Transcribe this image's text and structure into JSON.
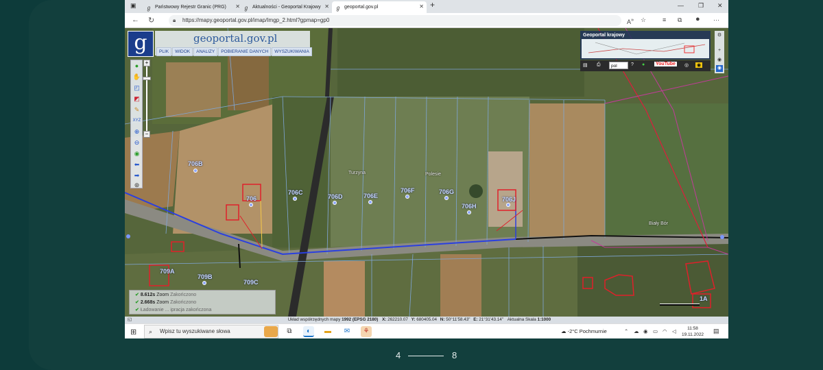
{
  "browser": {
    "tabs": [
      {
        "label": "Państwowy Rejestr Granic (PRG)"
      },
      {
        "label": "Aktualności - Geoportal Krajowy"
      },
      {
        "label": "geoportal.gov.pl"
      }
    ],
    "url": "https://mapy.geoportal.gov.pl/imap/Imgp_2.html?gpmap=gp0"
  },
  "geoportal": {
    "logo_letter": "g",
    "brand": "geoportal.gov.pl",
    "menu": [
      "PLIK",
      "WIDOK",
      "ANALIZY",
      "POBIERANIE DANYCH",
      "WYSZUKIWANIA"
    ],
    "minimap_title": "Geoportal krajowy",
    "language": "pol",
    "youtube_label": "YouTube"
  },
  "parcels": [
    {
      "id": "706B"
    },
    {
      "id": "706"
    },
    {
      "id": "706C"
    },
    {
      "id": "706D"
    },
    {
      "id": "706E"
    },
    {
      "id": "706F"
    },
    {
      "id": "706G"
    },
    {
      "id": "706H"
    },
    {
      "id": "706J"
    },
    {
      "id": "709A"
    },
    {
      "id": "709B"
    },
    {
      "id": "709C"
    },
    {
      "id": "1A"
    }
  ],
  "places": {
    "place1": "Turzyna",
    "place2": "Polesie",
    "place3": "Biały Bór"
  },
  "log": [
    {
      "time": "8.612s",
      "action": "Zoom",
      "status": "Zakończono"
    },
    {
      "time": "2.668s",
      "action": "Zoom",
      "status": "Zakończono"
    },
    {
      "time": "",
      "action": "",
      "status": "Ładowanie ... ipracja zakończona"
    }
  ],
  "status": {
    "coords_label": "Układ współrzędnych mapy",
    "crs": "1992 (EPSG 2180)",
    "x_label": "X:",
    "x": "262210.07",
    "y_label": "Y:",
    "y": "680405.04",
    "n_label": "N:",
    "n": "50°11'58.43\"",
    "e_label": "E:",
    "e": "21°31'43.14\"",
    "scale_label": "Aktualna Skala",
    "scale": "1:1000"
  },
  "taskbar": {
    "search_placeholder": "Wpisz tu wyszukiwane słowa",
    "weather": "-2°C Pochmurnie",
    "time": "11:58",
    "date": "19.11.2022"
  },
  "pager": {
    "current": "4",
    "total": "8"
  }
}
